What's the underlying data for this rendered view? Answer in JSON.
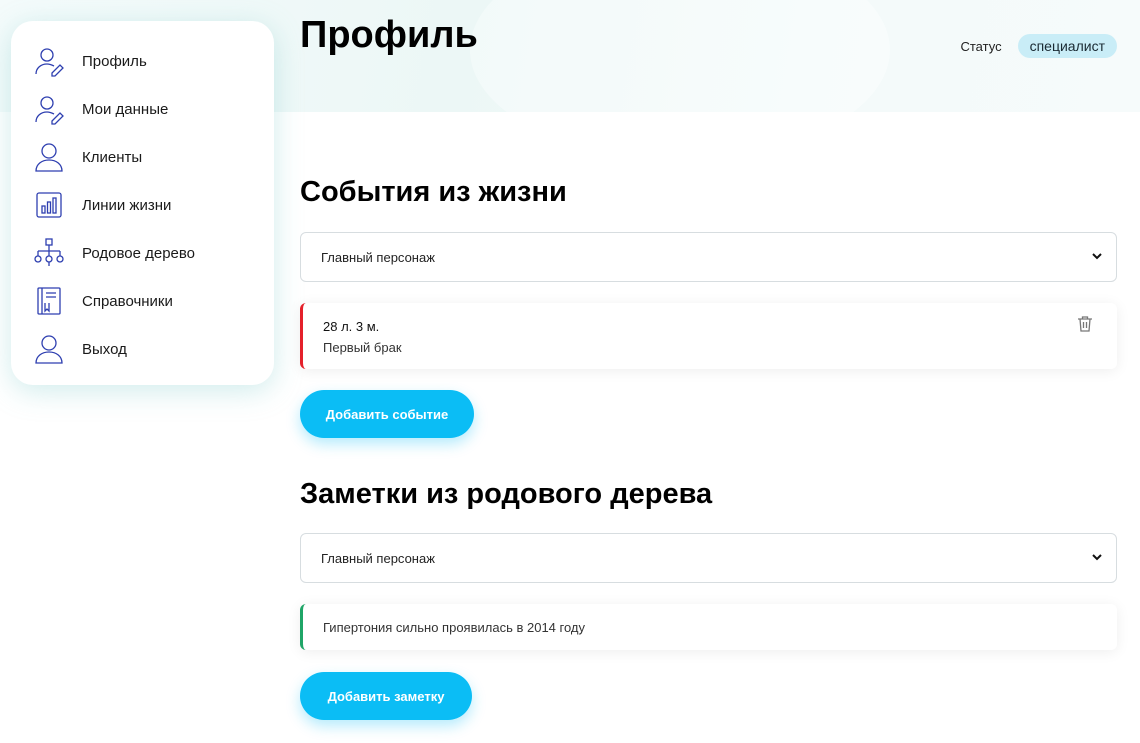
{
  "sidebar": {
    "items": [
      {
        "label": "Профиль",
        "icon": "user-edit-icon"
      },
      {
        "label": "Мои данные",
        "icon": "user-edit-icon"
      },
      {
        "label": "Клиенты",
        "icon": "user-icon"
      },
      {
        "label": "Линии жизни",
        "icon": "bar-chart-icon"
      },
      {
        "label": "Родовое дерево",
        "icon": "tree-icon"
      },
      {
        "label": "Справочники",
        "icon": "book-icon"
      },
      {
        "label": "Выход",
        "icon": "user-icon"
      }
    ]
  },
  "header": {
    "title": "Профиль",
    "status_label": "Статус",
    "status_value": "специалист"
  },
  "events": {
    "title": "События из жизни",
    "select_value": "Главный персонаж",
    "items": [
      {
        "age": "28 л. 3 м.",
        "text": "Первый брак",
        "color": "#e4202a"
      }
    ],
    "add_button": "Добавить событие"
  },
  "notes": {
    "title": "Заметки из родового дерева",
    "select_value": "Главный персонаж",
    "items": [
      {
        "text": "Гипертония сильно проявилась в 2014 году",
        "color": "#1fa567"
      }
    ],
    "add_button": "Добавить заметку"
  },
  "colors": {
    "accent": "#0bbdf5",
    "icon": "#2e3fb0",
    "badge_bg": "#c9edf7"
  }
}
